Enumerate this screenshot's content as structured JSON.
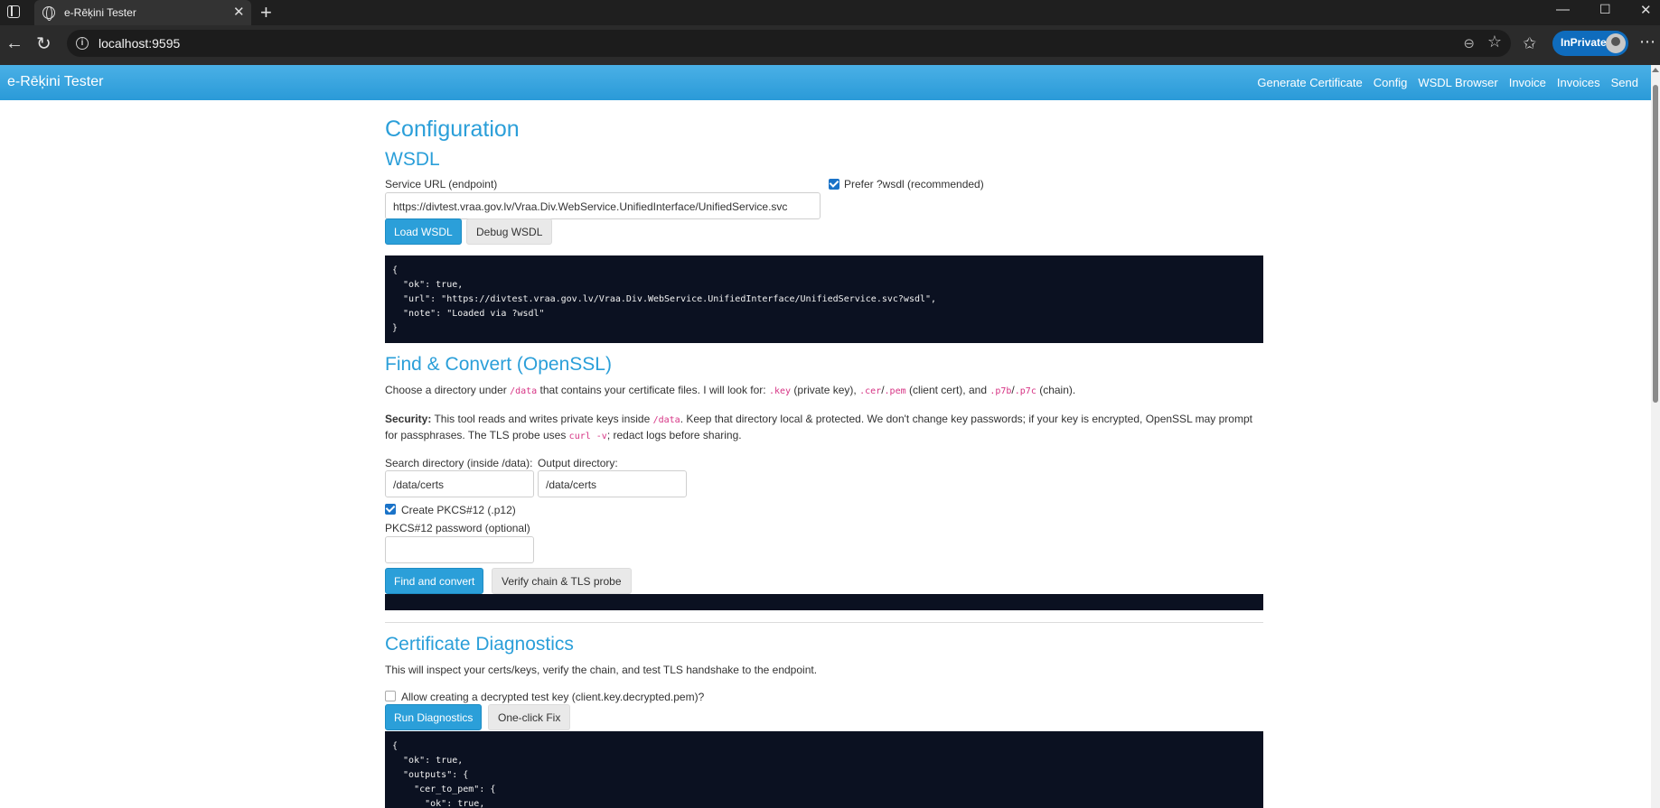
{
  "browser": {
    "tab_title": "e-Rēķini Tester",
    "url": "localhost:9595",
    "inprivate_label": "InPrivate"
  },
  "navbar": {
    "brand": "e-Rēķini Tester",
    "links": [
      "Generate Certificate",
      "Config",
      "WSDL Browser",
      "Invoice",
      "Invoices",
      "Send"
    ]
  },
  "page": {
    "title": "Configuration"
  },
  "wsdl": {
    "heading": "WSDL",
    "service_url_label": "Service URL (endpoint)",
    "service_url_value": "https://divtest.vraa.gov.lv/Vraa.Div.WebService.UnifiedInterface/UnifiedService.svc",
    "prefer_wsdl_label": "Prefer ?wsdl (recommended)",
    "load_button": "Load WSDL",
    "debug_button": "Debug WSDL",
    "output": "{\n  \"ok\": true,\n  \"url\": \"https://divtest.vraa.gov.lv/Vraa.Div.WebService.UnifiedInterface/UnifiedService.svc?wsdl\",\n  \"note\": \"Loaded via ?wsdl\"\n}"
  },
  "convert": {
    "heading": "Find & Convert (OpenSSL)",
    "intro_1": "Choose a directory under ",
    "intro_code_1": "/data",
    "intro_2": " that contains your certificate files. I will look for: ",
    "intro_code_2": ".key",
    "intro_3": " (private key), ",
    "intro_code_3": ".cer",
    "intro_4": "/",
    "intro_code_4": ".pem",
    "intro_5": " (client cert), and ",
    "intro_code_5": ".p7b",
    "intro_6": "/",
    "intro_code_6": ".p7c",
    "intro_7": " (chain).",
    "security_label": "Security:",
    "security_1": " This tool reads and writes private keys inside ",
    "security_code_1": "/data",
    "security_2": ". Keep that directory local & protected. We don't change key passwords; if your key is encrypted, OpenSSL may prompt for passphrases. The TLS probe uses ",
    "security_code_2": "curl -v",
    "security_3": "; redact logs before sharing.",
    "search_dir_label": "Search directory (inside /data):",
    "search_dir_value": "/data/certs",
    "output_dir_label": "Output directory:",
    "output_dir_value": "/data/certs",
    "create_p12_label": "Create PKCS#12 (.p12)",
    "p12_password_label": "PKCS#12 password (optional)",
    "find_button": "Find and convert",
    "verify_button": "Verify chain & TLS probe"
  },
  "diagnostics": {
    "heading": "Certificate Diagnostics",
    "intro": "This will inspect your certs/keys, verify the chain, and test TLS handshake to the endpoint.",
    "allow_label": "Allow creating a decrypted test key (client.key.decrypted.pem)?",
    "run_button": "Run Diagnostics",
    "fix_button": "One-click Fix",
    "output": "{\n  \"ok\": true,\n  \"outputs\": {\n    \"cer_to_pem\": {\n      \"ok\": true,"
  }
}
